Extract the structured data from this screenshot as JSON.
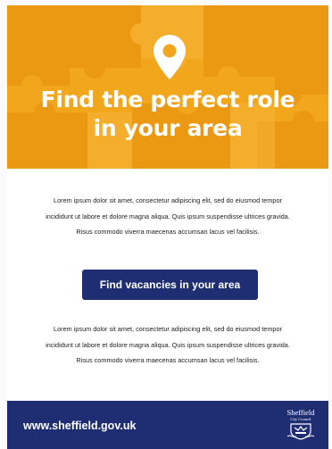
{
  "hero": {
    "title_line1": "Find the perfect role",
    "title_line2": "in your area",
    "icon": "location-pin-icon",
    "background_color": "#f2a61c"
  },
  "content": {
    "paragraph_1": "Lorem ipsum dolor sit amet, consectetur adipiscing elit, sed do eiusmod tempor incididunt ut labore et dolore magna aliqua. Quis ipsum suspendisse ultrices gravida. Risus commodo viverra maecenas accumsan lacus vel facilisis.",
    "cta_label": "Find vacancies in your area",
    "paragraph_2": "Lorem ipsum dolor sit amet, consectetur adipiscing elit, sed do eiusmod tempor incididunt ut labore et dolore magna aliqua. Quis ipsum suspendisse ultrices gravida. Risus commodo viverra maecenas accumsan lacus vel facilisis."
  },
  "footer": {
    "url_text": "www.sheffield.gov.uk",
    "logo_word": "Sheffield",
    "logo_sub": "City Council",
    "background_color": "#1f2d73"
  }
}
